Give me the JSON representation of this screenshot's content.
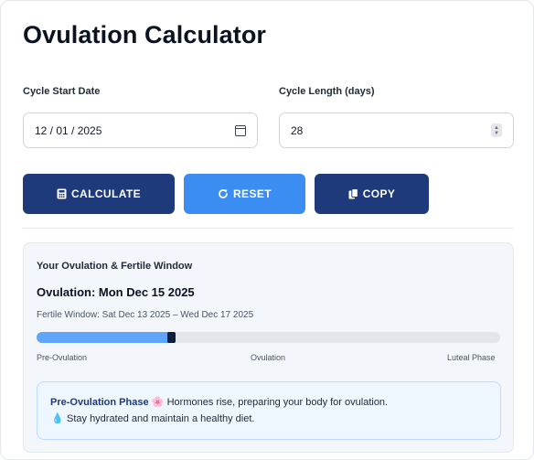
{
  "title": "Ovulation Calculator",
  "form": {
    "start_date_label": "Cycle Start Date",
    "start_date_value": "12 / 01 / 2025",
    "cycle_length_label": "Cycle Length (days)",
    "cycle_length_value": "28"
  },
  "buttons": {
    "calculate": "CALCULATE",
    "reset": "RESET",
    "copy": "COPY"
  },
  "result": {
    "heading": "Your Ovulation & Fertile Window",
    "ovulation": "Ovulation: Mon Dec 15 2025",
    "fertile_window": "Fertile Window: Sat Dec 13 2025 – Wed Dec 17 2025",
    "progress_fraction": 0.29,
    "phase_labels": {
      "left": "Pre-Ovulation",
      "middle": "Ovulation",
      "right": "Luteal Phase"
    },
    "phase_box": {
      "phase_name": "Pre-Ovulation Phase",
      "phase_emoji": "🌸",
      "phase_text": "Hormones rise, preparing your body for ovulation.",
      "tip_emoji": "💧",
      "tip_text": "Stay hydrated and maintain a healthy diet."
    }
  },
  "colors": {
    "primary_dark": "#1e3a7b",
    "primary_blue": "#3b8df1",
    "progress_fill": "#60a5fa",
    "progress_marker": "#0f1d3d"
  },
  "icons": {
    "calculate": "calculator-icon",
    "reset": "refresh-icon",
    "copy": "copy-icon",
    "date": "calendar-icon"
  }
}
